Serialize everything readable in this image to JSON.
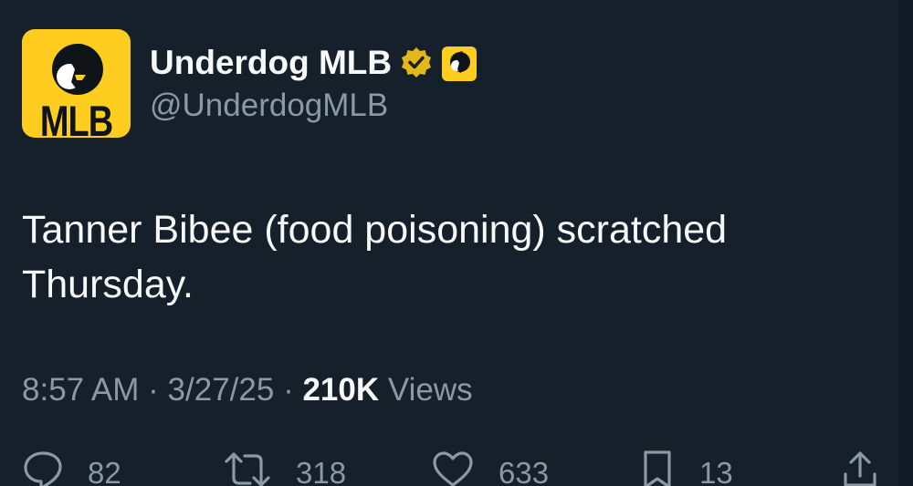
{
  "author": {
    "display_name": "Underdog MLB",
    "handle": "@UnderdogMLB",
    "avatar_text": "MLB",
    "verified": true,
    "avatar_color": "#ffcd1f",
    "verified_color": "#e2b719"
  },
  "tweet": {
    "text": "Tanner Bibee (food poisoning) scratched Thursday.",
    "time": "8:57 AM",
    "date": "3/27/25",
    "views_count": "210K",
    "views_label": "Views",
    "separator": "·"
  },
  "actions": [
    {
      "icon": "reply-icon",
      "count": "82"
    },
    {
      "icon": "retweet-icon",
      "count": "318"
    },
    {
      "icon": "like-icon",
      "count": "633"
    },
    {
      "icon": "bookmark-icon",
      "count": "13"
    },
    {
      "icon": "share-icon",
      "count": ""
    }
  ],
  "colors": {
    "background": "#15202b",
    "primary_text": "#f7f9f9",
    "secondary_text": "#8b98a5"
  }
}
